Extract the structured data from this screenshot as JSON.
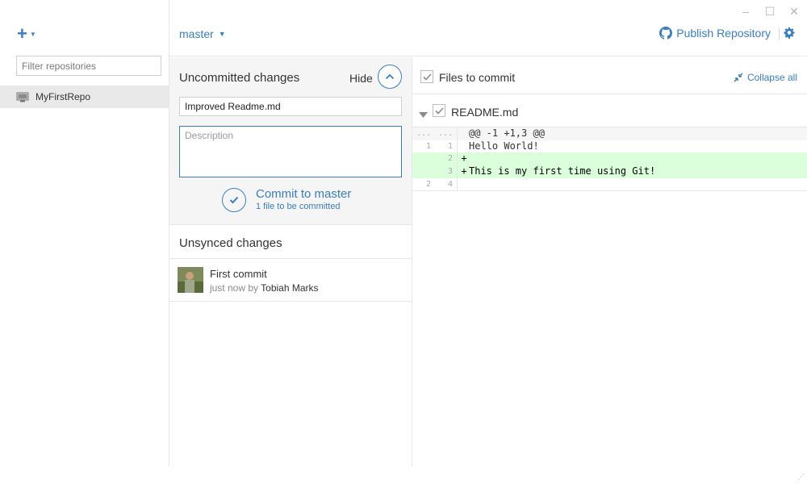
{
  "window": {
    "minimize_glyph": "–",
    "maximize_glyph": "☐",
    "close_glyph": "✕"
  },
  "sidebar": {
    "add_glyph": "+",
    "filter_placeholder": "Filter repositories",
    "repos": [
      {
        "name": "MyFirstRepo",
        "icon": "computer-icon"
      }
    ]
  },
  "topbar": {
    "branch": "master",
    "publish_label": "Publish Repository",
    "publish_icon": "github-icon",
    "settings_icon": "gear-icon"
  },
  "uncommitted": {
    "title": "Uncommitted changes",
    "hide_label": "Hide",
    "summary_value": "Improved Readme.md",
    "description_placeholder": "Description",
    "commit_label": "Commit to master",
    "commit_sub": "1 file to be committed"
  },
  "unsynced": {
    "title": "Unsynced changes",
    "commits": [
      {
        "title": "First commit",
        "time": "just now by",
        "author": "Tobiah Marks"
      }
    ]
  },
  "files_to_commit": {
    "label": "Files to commit",
    "collapse_label": "Collapse all",
    "files": [
      {
        "name": "README.md",
        "checked": true
      }
    ]
  },
  "diff": {
    "hunk_old": "...",
    "hunk_new": "...",
    "hunk": "@@ -1 +1,3 @@",
    "lines": [
      {
        "old": "1",
        "new": "1",
        "marker": "",
        "code": "Hello World!"
      },
      {
        "old": "",
        "new": "2",
        "marker": "+",
        "code": ""
      },
      {
        "old": "",
        "new": "3",
        "marker": "+",
        "code": "This is my first time using Git!"
      },
      {
        "old": "2",
        "new": "4",
        "marker": "",
        "code": ""
      }
    ]
  },
  "colors": {
    "accent": "#3a7ebf",
    "added_line_bg": "#dbffdb"
  }
}
